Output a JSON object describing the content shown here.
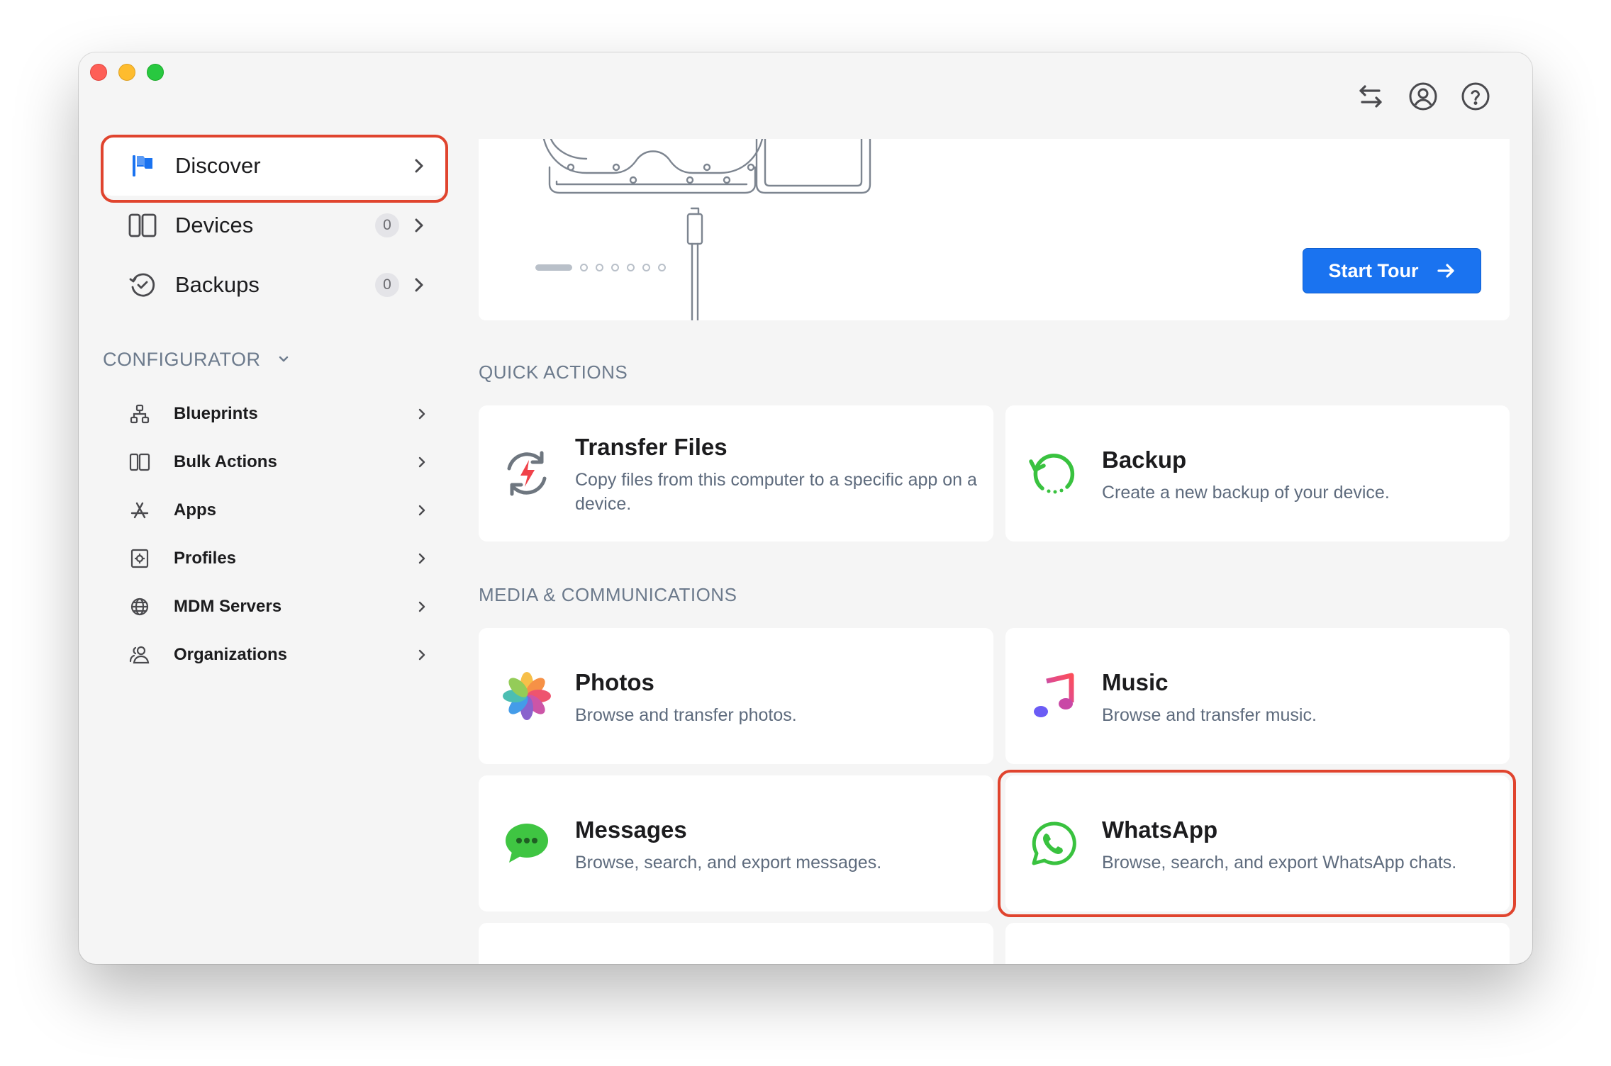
{
  "window": {
    "traffic_lights": [
      "close",
      "minimize",
      "zoom"
    ],
    "toolbar_icons": [
      "transfer-arrows-icon",
      "account-circle-icon",
      "help-circle-icon"
    ]
  },
  "sidebar": {
    "items": [
      {
        "label": "Discover",
        "icon": "flag-icon",
        "badge": null
      },
      {
        "label": "Devices",
        "icon": "devices-icon",
        "badge": "0"
      },
      {
        "label": "Backups",
        "icon": "backup-history-icon",
        "badge": "0"
      }
    ],
    "configurator": {
      "title": "CONFIGURATOR",
      "items": [
        {
          "label": "Blueprints",
          "icon": "hierarchy-icon"
        },
        {
          "label": "Bulk Actions",
          "icon": "devices-icon"
        },
        {
          "label": "Apps",
          "icon": "app-store-icon"
        },
        {
          "label": "Profiles",
          "icon": "profile-gear-icon"
        },
        {
          "label": "MDM Servers",
          "icon": "globe-icon"
        },
        {
          "label": "Organizations",
          "icon": "people-icon"
        }
      ]
    }
  },
  "hero": {
    "button_label": "Start Tour",
    "carousel_pages": 7,
    "carousel_active_index": 0
  },
  "quick_actions": {
    "title": "QUICK ACTIONS",
    "cards": [
      {
        "title": "Transfer Files",
        "description": "Copy files from this computer to a specific app on a device.",
        "icon": "transfer-files-icon"
      },
      {
        "title": "Backup",
        "description": "Create a new backup of your device.",
        "icon": "backup-icon"
      }
    ]
  },
  "media": {
    "title": "MEDIA & COMMUNICATIONS",
    "cards": [
      {
        "title": "Photos",
        "description": "Browse and transfer photos.",
        "icon": "photos-icon"
      },
      {
        "title": "Music",
        "description": "Browse and transfer music.",
        "icon": "music-icon"
      },
      {
        "title": "Messages",
        "description": "Browse, search, and export messages.",
        "icon": "messages-icon"
      },
      {
        "title": "WhatsApp",
        "description": "Browse, search, and export WhatsApp chats.",
        "icon": "whatsapp-icon"
      }
    ]
  },
  "colors": {
    "accent": "#1a73f0",
    "highlight": "#e0442e",
    "window_bg": "#f5f5f5",
    "muted_text": "#6c7a8c"
  }
}
